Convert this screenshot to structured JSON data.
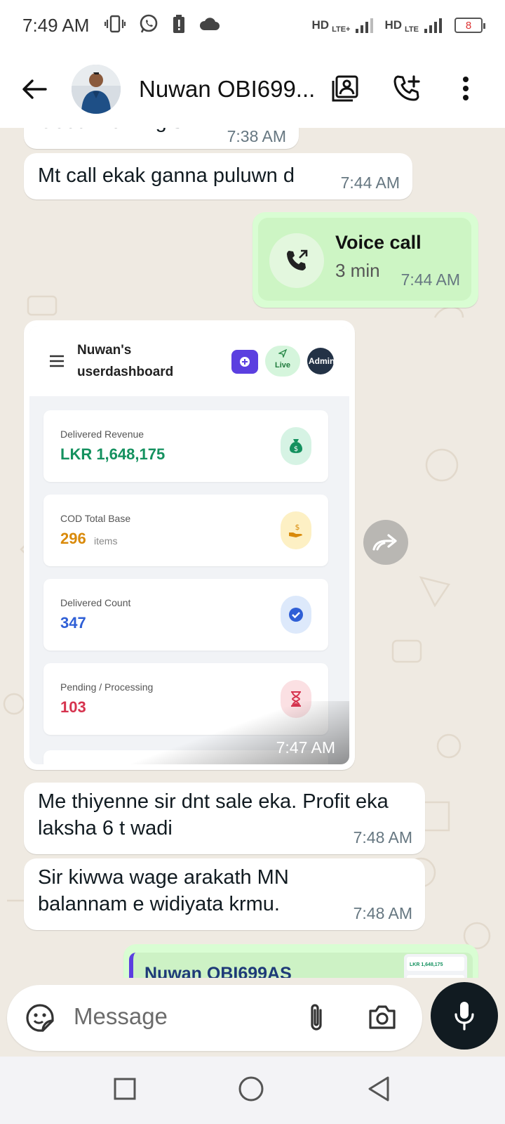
{
  "status_bar": {
    "time": "7:49 AM",
    "network1": "HD",
    "network1_type": "LTE+",
    "network2": "HD",
    "network2_type": "LTE",
    "battery": "8",
    "icons": [
      "vibrate-icon",
      "whatsapp-icon",
      "battery-alert-icon",
      "cloud-icon"
    ]
  },
  "header": {
    "contact_name": "Nuwan OBI699...",
    "icons": [
      "back-arrow-icon",
      "contact-card-icon",
      "add-call-icon",
      "more-vert-icon"
    ]
  },
  "messages": [
    {
      "direction": "in",
      "text": "Good Morning sir",
      "time": "7:38 AM"
    },
    {
      "direction": "in",
      "text": "Mt call ekak ganna puluwn d",
      "time": "7:44 AM"
    },
    {
      "direction": "out",
      "type": "voice_call",
      "title": "Voice call",
      "duration": "3 min",
      "time": "7:44 AM"
    },
    {
      "direction": "in",
      "type": "image",
      "time": "7:47 AM"
    },
    {
      "direction": "in",
      "text": "Me thiyenne sir dnt sale eka. Profit eka laksha 6 t wadi",
      "time": "7:48 AM"
    },
    {
      "direction": "in",
      "text": "Sir kiwwa wage arakath MN balannam e widiyata krmu.",
      "time": "7:48 AM"
    },
    {
      "direction": "out",
      "type": "reply_preview",
      "quoted_name": "Nuwan OBI699AS",
      "thumb_value": "LKR 1,648,175"
    }
  ],
  "dashboard_image": {
    "title_line1": "Nuwan's",
    "title_line2": "userdashboard",
    "live_label": "Live",
    "admin_label": "Admin",
    "cards": [
      {
        "label": "Delivered Revenue",
        "value": "LKR 1,648,175",
        "suffix": "",
        "color": "#14915f",
        "icon": "money-bag-icon",
        "icon_bg": "#d6f3e4"
      },
      {
        "label": "COD Total Base",
        "value": "296",
        "suffix": "items",
        "color": "#d98a0b",
        "icon": "cash-hand-icon",
        "icon_bg": "#fdf0c4"
      },
      {
        "label": "Delivered Count",
        "value": "347",
        "suffix": "",
        "color": "#2f5fd6",
        "icon": "check-circle-icon",
        "icon_bg": "#dde9fb"
      },
      {
        "label": "Pending / Processing",
        "value": "103",
        "suffix": "",
        "color": "#d6334e",
        "icon": "hourglass-icon",
        "icon_bg": "#fbe0e3"
      }
    ]
  },
  "composer": {
    "placeholder": "Message",
    "icons": [
      "sticker-icon",
      "attach-icon",
      "camera-icon",
      "mic-icon"
    ]
  },
  "nav_bar": {
    "icons": [
      "recents-square-icon",
      "home-circle-icon",
      "back-triangle-icon"
    ]
  },
  "colors": {
    "chat_bg": "#efeae2",
    "outgoing_bubble": "#d9fdd3",
    "incoming_bubble": "#ffffff",
    "mic_button": "#111b21"
  }
}
